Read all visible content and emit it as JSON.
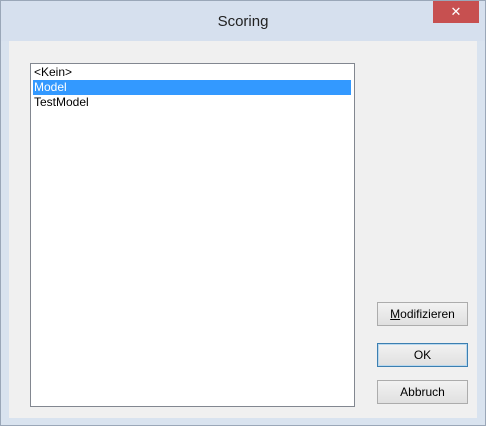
{
  "window": {
    "title": "Scoring",
    "close_glyph": "✕"
  },
  "list": {
    "items": [
      {
        "label": "<Kein>",
        "selected": false
      },
      {
        "label": "Model",
        "selected": true
      },
      {
        "label": "TestModel",
        "selected": false
      }
    ]
  },
  "buttons": {
    "modify_accel": "M",
    "modify_rest": "odifizieren",
    "ok": "OK",
    "cancel": "Abbruch"
  },
  "colors": {
    "selection": "#3399ff",
    "close_button": "#c75050"
  }
}
